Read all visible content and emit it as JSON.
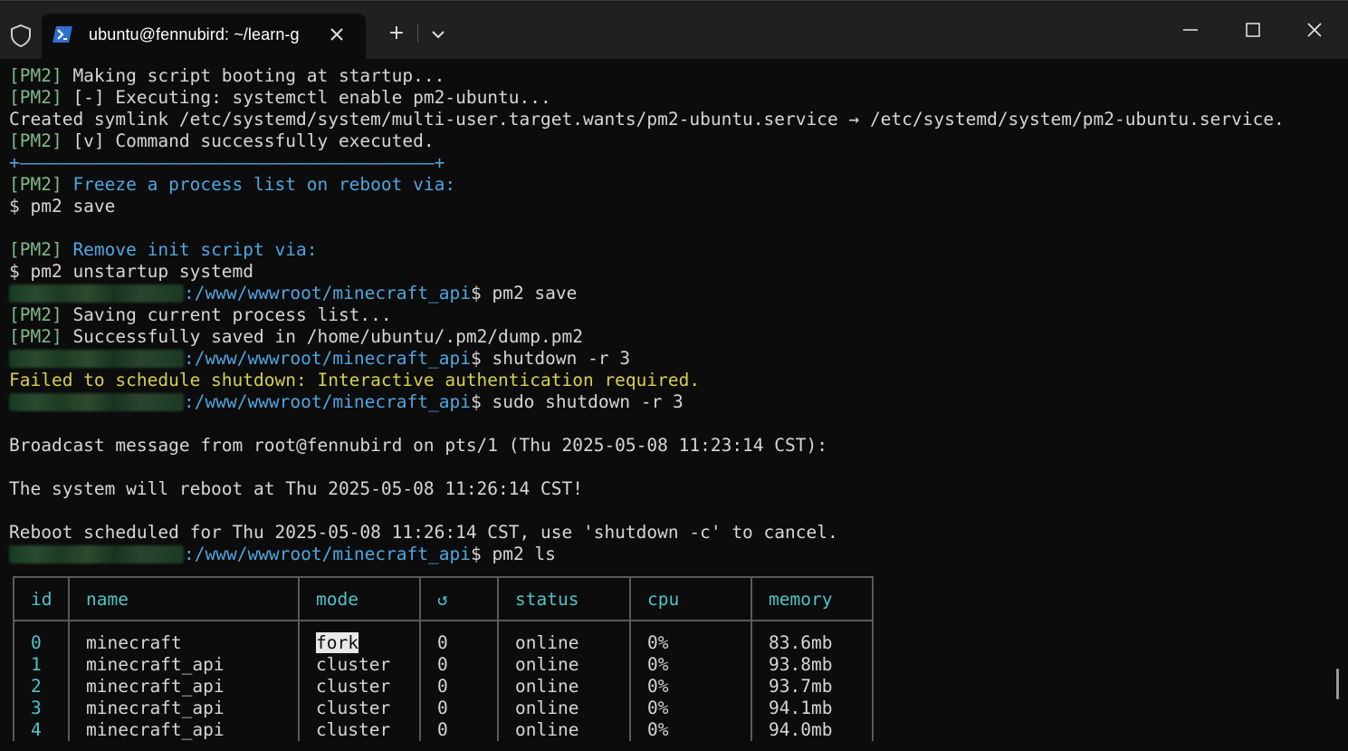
{
  "window": {
    "tab_title": "ubuntu@fennubird: ~/learn-g",
    "tab_icon": "powershell-icon",
    "new_tab_label": "+"
  },
  "terminal": {
    "l1_tag": "[PM2]",
    "l1_text": " Making script booting at startup...",
    "l2_tag": "[PM2]",
    "l2_text": " [-] Executing: systemctl enable pm2-ubuntu...",
    "l3_text": "Created symlink /etc/systemd/system/multi-user.target.wants/pm2-ubuntu.service → /etc/systemd/system/pm2-ubuntu.service.",
    "l4_tag": "[PM2]",
    "l4_text": " [v] Command successfully executed.",
    "l5_text": "+———————————————————————————————————————+",
    "l6_tag": "[PM2]",
    "l6_text": " Freeze a process list on reboot via:",
    "l7_text": "$ pm2 save",
    "l9_tag": "[PM2]",
    "l9_text": " Remove init script via:",
    "l10_text": "$ pm2 unstartup systemd",
    "l11_path": ":/www/wwwroot/minecraft_api",
    "l11_cmd": "$ pm2 save",
    "l12_tag": "[PM2]",
    "l12_text": " Saving current process list...",
    "l13_tag": "[PM2]",
    "l13_text": " Successfully saved in /home/ubuntu/.pm2/dump.pm2",
    "l14_path": ":/www/wwwroot/minecraft_api",
    "l14_cmd": "$ shutdown -r 3",
    "l15_text": "Failed to schedule shutdown: Interactive authentication required.",
    "l16_path": ":/www/wwwroot/minecraft_api",
    "l16_cmd": "$ sudo shutdown -r 3",
    "l18_text": "Broadcast message from root@fennubird on pts/1 (Thu 2025-05-08 11:23:14 CST):",
    "l20_text": "The system will reboot at Thu 2025-05-08 11:26:14 CST!",
    "l22_text": "Reboot scheduled for Thu 2025-05-08 11:26:14 CST, use 'shutdown -c' to cancel.",
    "l23_path": ":/www/wwwroot/minecraft_api",
    "l23_cmd": "$ pm2 ls"
  },
  "table": {
    "headers": [
      "id",
      "name",
      "mode",
      "↺",
      "status",
      "cpu",
      "memory"
    ],
    "rows": [
      {
        "id": "0",
        "name": "minecraft",
        "mode": "fork",
        "restarts": "0",
        "status": "online",
        "cpu": "0%",
        "memory": "83.6mb"
      },
      {
        "id": "1",
        "name": "minecraft_api",
        "mode": "cluster",
        "restarts": "0",
        "status": "online",
        "cpu": "0%",
        "memory": "93.8mb"
      },
      {
        "id": "2",
        "name": "minecraft_api",
        "mode": "cluster",
        "restarts": "0",
        "status": "online",
        "cpu": "0%",
        "memory": "93.7mb"
      },
      {
        "id": "3",
        "name": "minecraft_api",
        "mode": "cluster",
        "restarts": "0",
        "status": "online",
        "cpu": "0%",
        "memory": "94.1mb"
      },
      {
        "id": "4",
        "name": "minecraft_api",
        "mode": "cluster",
        "restarts": "0",
        "status": "online",
        "cpu": "0%",
        "memory": "94.0mb"
      }
    ]
  },
  "colors": {
    "background": "#0c0c0c",
    "titlebar": "#202020",
    "pm2_tag": "#7fb88b",
    "path_blue": "#4fa6e0",
    "warning_yellow": "#d6d04e",
    "header_cyan": "#4fc1c9",
    "online_green": "#3db87a"
  }
}
